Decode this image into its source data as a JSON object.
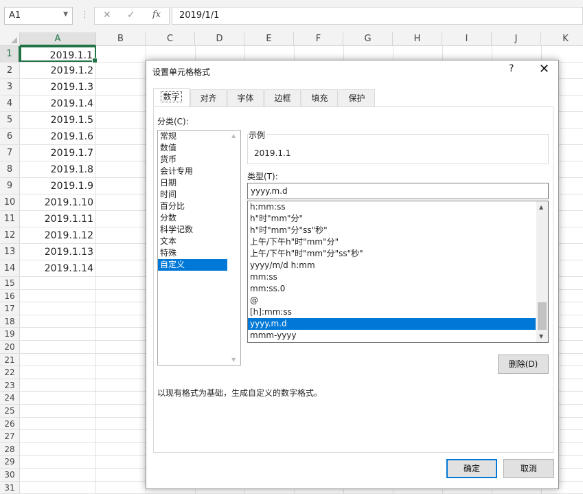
{
  "formula_bar": {
    "name_box": "A1",
    "separator": "⋮",
    "cancel_icon": "✕",
    "enter_icon": "✓",
    "fx_label": "fx",
    "formula": "2019/1/1"
  },
  "columns": [
    "A",
    "B",
    "C",
    "D",
    "E",
    "F",
    "G",
    "H",
    "I",
    "J",
    "K"
  ],
  "rows": [
    {
      "n": "1",
      "a": "2019.1.1"
    },
    {
      "n": "2",
      "a": "2019.1.2"
    },
    {
      "n": "3",
      "a": "2019.1.3"
    },
    {
      "n": "4",
      "a": "2019.1.4"
    },
    {
      "n": "5",
      "a": "2019.1.5"
    },
    {
      "n": "6",
      "a": "2019.1.6"
    },
    {
      "n": "7",
      "a": "2019.1.7"
    },
    {
      "n": "8",
      "a": "2019.1.8"
    },
    {
      "n": "9",
      "a": "2019.1.9"
    },
    {
      "n": "10",
      "a": "2019.1.10"
    },
    {
      "n": "11",
      "a": "2019.1.11"
    },
    {
      "n": "12",
      "a": "2019.1.12"
    },
    {
      "n": "13",
      "a": "2019.1.13"
    },
    {
      "n": "14",
      "a": "2019.1.14"
    },
    {
      "n": "15",
      "a": ""
    },
    {
      "n": "16",
      "a": ""
    },
    {
      "n": "17",
      "a": ""
    },
    {
      "n": "18",
      "a": ""
    },
    {
      "n": "19",
      "a": ""
    },
    {
      "n": "20",
      "a": ""
    },
    {
      "n": "21",
      "a": ""
    },
    {
      "n": "22",
      "a": ""
    },
    {
      "n": "23",
      "a": ""
    },
    {
      "n": "24",
      "a": ""
    },
    {
      "n": "25",
      "a": ""
    },
    {
      "n": "26",
      "a": ""
    },
    {
      "n": "27",
      "a": ""
    },
    {
      "n": "28",
      "a": ""
    },
    {
      "n": "29",
      "a": ""
    },
    {
      "n": "30",
      "a": ""
    },
    {
      "n": "31",
      "a": ""
    }
  ],
  "dialog": {
    "title": "设置单元格格式",
    "help": "?",
    "close": "✕",
    "tabs": [
      "数字",
      "对齐",
      "字体",
      "边框",
      "填充",
      "保护"
    ],
    "active_tab": 0,
    "category_label": "分类(C):",
    "categories": [
      "常规",
      "数值",
      "货币",
      "会计专用",
      "日期",
      "时间",
      "百分比",
      "分数",
      "科学记数",
      "文本",
      "特殊",
      "自定义"
    ],
    "selected_category": 11,
    "sample_label": "示例",
    "sample_value": "2019.1.1",
    "type_label": "类型(T):",
    "type_value": "yyyy.m.d",
    "formats": [
      "h:mm:ss",
      "h\"时\"mm\"分\"",
      "h\"时\"mm\"分\"ss\"秒\"",
      "上午/下午h\"时\"mm\"分\"",
      "上午/下午h\"时\"mm\"分\"ss\"秒\"",
      "yyyy/m/d h:mm",
      "mm:ss",
      "mm:ss.0",
      "@",
      "[h]:mm:ss",
      "yyyy.m.d",
      "mmm-yyyy"
    ],
    "selected_format": 10,
    "delete_button": "删除(D)",
    "description": "以现有格式为基础，生成自定义的数字格式。",
    "ok_button": "确定",
    "cancel_button": "取消"
  },
  "colors": {
    "excel_green": "#217346",
    "selection_blue": "#0078d7"
  }
}
